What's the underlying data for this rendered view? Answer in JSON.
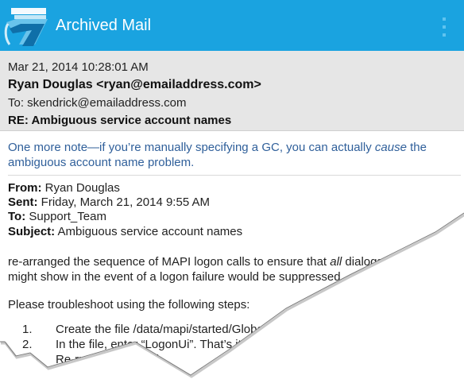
{
  "app": {
    "title": "Archived Mail"
  },
  "header": {
    "date": "Mar 21, 2014 10:28:01 AM",
    "from": "Ryan Douglas <ryan@emailaddress.com>",
    "to": "To: skendrick@emailaddress.com",
    "subject": "RE: Ambiguous service account names"
  },
  "note": {
    "line1_a": "One more note—if you’re manually specifying a GC, you can actually ",
    "line1_em": "cause",
    "line1_b": " the",
    "line2": "ambiguous account name problem."
  },
  "forwarded": {
    "from_label": "From:",
    "from_value": " Ryan Douglas",
    "sent_label": "Sent:",
    "sent_value": " Friday, March 21, 2014 9:55 AM",
    "to_label": "To:",
    "to_value": " Support_Team",
    "subject_label": "Subject:",
    "subject_value": " Ambiguous service account names"
  },
  "body": {
    "p1_a": "re-arranged the sequence of MAPI logon calls to ensure that ",
    "p1_em": "all",
    "p1_b": " dialogs th",
    "p1_line2": "might show in the event of a logon failure would be suppressed.",
    "p2": "Please troubleshoot using the following steps:",
    "steps": [
      {
        "num": "1.",
        "text": "Create the file /data/mapi/started/Global-"
      },
      {
        "num": "2.",
        "text": "In the file, enter “LogonUi”.  That’s it"
      },
      {
        "num": "3.",
        "text": "Re-run the failed job"
      }
    ]
  },
  "colors": {
    "appbar": "#1aa3e0",
    "header_bg": "#e6e6e6",
    "note_text": "#2f5f9a"
  }
}
